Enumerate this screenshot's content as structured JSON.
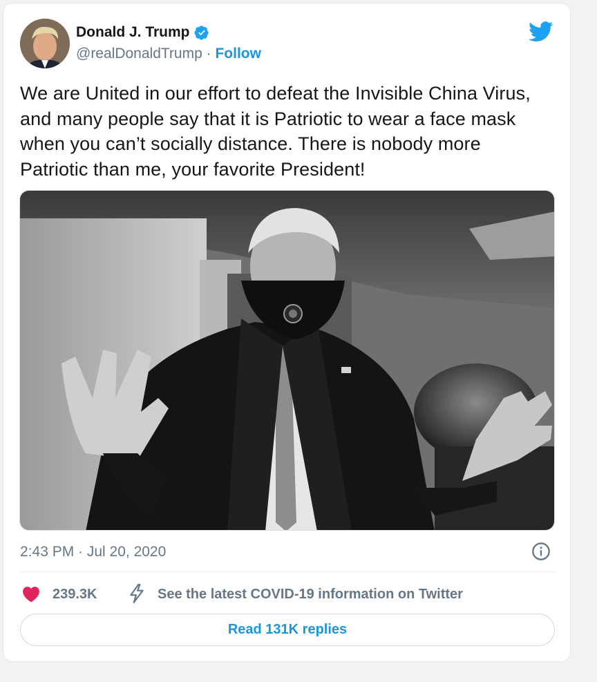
{
  "user": {
    "display_name": "Donald J. Trump",
    "handle": "@realDonaldTrump",
    "separator": " · ",
    "follow_label": "Follow",
    "verified": true
  },
  "tweet": {
    "text": "We are United in our effort to defeat the Invisible China Virus, and many people say that it is Patriotic to wear a face mask when you can’t socially distance. There is nobody more Patriotic than me, your favorite President!",
    "timestamp": "2:43 PM · Jul 20, 2020"
  },
  "actions": {
    "likes": "239.3K",
    "covid_info": "See the latest COVID-19 information on Twitter",
    "read_replies": "Read 131K replies"
  },
  "icons": {
    "verified": "verified-badge-icon",
    "logo": "twitter-bird-icon",
    "info": "info-icon",
    "like": "heart-icon",
    "covid": "lightning-bolt-icon"
  },
  "colors": {
    "link_blue": "#1b95e0",
    "heart": "#e0245e",
    "muted_text": "#657786",
    "text": "#14171a"
  }
}
